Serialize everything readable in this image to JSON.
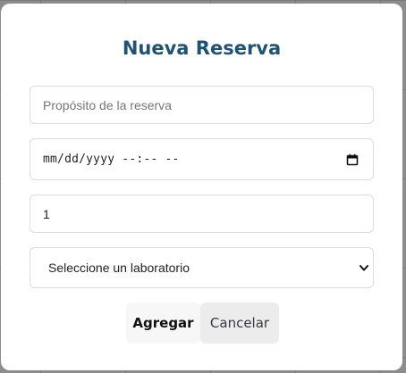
{
  "modal": {
    "title": "Nueva Reserva",
    "fields": {
      "purpose": {
        "placeholder": "Propósito de la reserva",
        "value": ""
      },
      "datetime": {
        "display": "mm/dd/yyyy --:-- --"
      },
      "count": {
        "value": "1"
      },
      "lab": {
        "selected": "Seleccione un laboratorio"
      }
    },
    "buttons": {
      "add_label": "Agregar",
      "cancel_label": "Cancelar"
    }
  },
  "icons": {
    "datetime": "calendar-icon",
    "select": "chevron-down-icon"
  }
}
